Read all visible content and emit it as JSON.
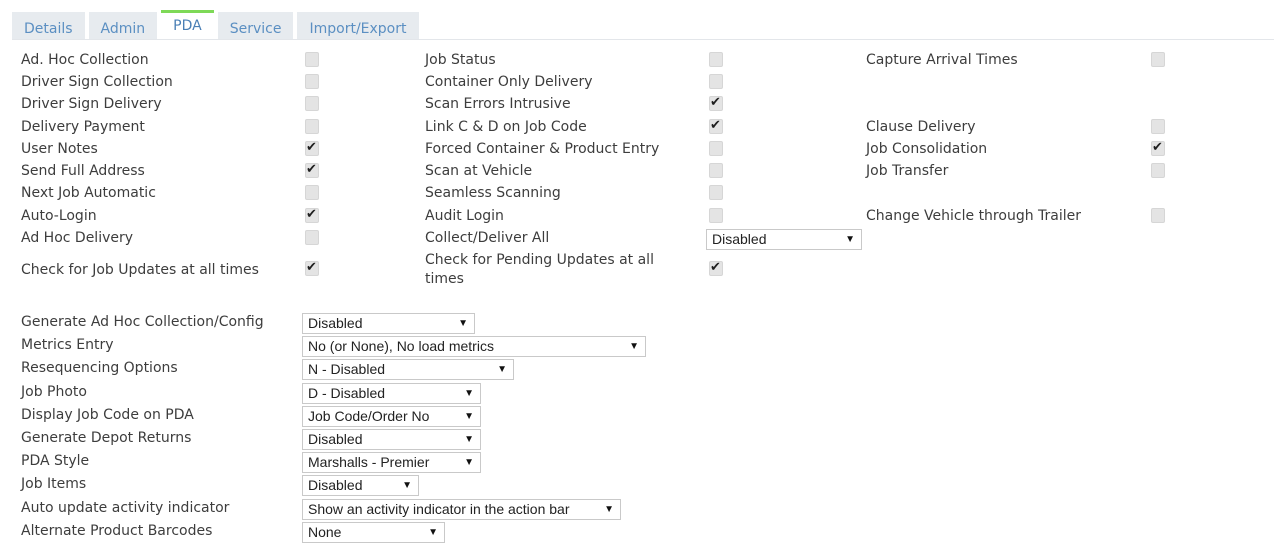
{
  "tabs": [
    "Details",
    "Admin",
    "PDA",
    "Service",
    "Import/Export"
  ],
  "active_tab": "PDA",
  "col1": [
    {
      "label": "Ad. Hoc Collection",
      "checked": false
    },
    {
      "label": "Driver Sign Collection",
      "checked": false
    },
    {
      "label": "Driver Sign Delivery",
      "checked": false
    },
    {
      "label": "Delivery Payment",
      "checked": false
    },
    {
      "label": "User Notes",
      "checked": true
    },
    {
      "label": "Send Full Address",
      "checked": true
    },
    {
      "label": "Next Job Automatic",
      "checked": false
    },
    {
      "label": "Auto-Login",
      "checked": true
    },
    {
      "label": "Ad Hoc Delivery",
      "checked": false
    },
    {
      "label": "Check for Job Updates at all times",
      "checked": true
    }
  ],
  "col2": [
    {
      "label": "Job Status",
      "checked": false
    },
    {
      "label": "Container Only Delivery",
      "checked": false
    },
    {
      "label": "Scan Errors Intrusive",
      "checked": true
    },
    {
      "label": "Link C & D on Job Code",
      "checked": true
    },
    {
      "label": "Forced Container & Product Entry",
      "checked": false
    },
    {
      "label": "Scan at Vehicle",
      "checked": false
    },
    {
      "label": "Seamless Scanning",
      "checked": false
    },
    {
      "label": "Audit Login",
      "checked": false
    },
    {
      "label": "Collect/Deliver All",
      "select": "Disabled"
    },
    {
      "label": "Check for Pending Updates at all times",
      "checked": true
    }
  ],
  "col3": [
    {
      "label": "Capture Arrival Times",
      "checked": false
    },
    {
      "label": "Clause Delivery",
      "checked": false
    },
    {
      "label": "Job Consolidation",
      "checked": true
    },
    {
      "label": "Job Transfer",
      "checked": false
    },
    {
      "label": "Change Vehicle through Trailer",
      "checked": false
    }
  ],
  "settings": [
    {
      "label": "Generate Ad Hoc Collection/Config",
      "value": "Disabled"
    },
    {
      "label": "Metrics Entry",
      "value": "No (or None), No load metrics"
    },
    {
      "label": "Resequencing Options",
      "value": "N - Disabled"
    },
    {
      "label": "Job Photo",
      "value": "D - Disabled"
    },
    {
      "label": "Display Job Code on PDA",
      "value": "Job Code/Order No"
    },
    {
      "label": "Generate Depot Returns",
      "value": "Disabled"
    },
    {
      "label": "PDA Style",
      "value": "Marshalls - Premier"
    },
    {
      "label": "Job Items",
      "value": "Disabled"
    },
    {
      "label": "Auto update activity indicator",
      "value": "Show an activity indicator in the action bar"
    },
    {
      "label": "Alternate Product Barcodes",
      "value": "None"
    }
  ]
}
